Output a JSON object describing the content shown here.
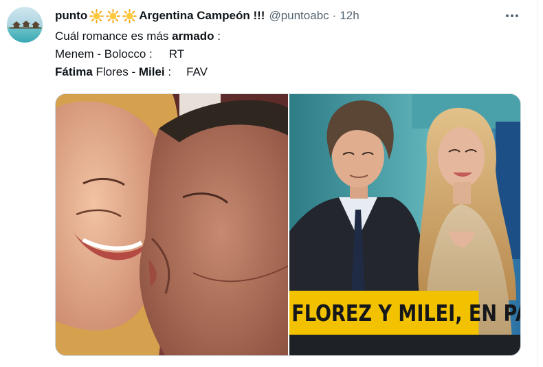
{
  "tweet": {
    "author": {
      "name": "punto",
      "name_suffix": "Argentina Campeón !!!",
      "name_emoji": [
        "sun-emoji",
        "sun-emoji",
        "sun-emoji"
      ],
      "handle": "@puntoabc",
      "separator": "·",
      "time": "12h",
      "avatar_icon": "beach-huts-avatar"
    },
    "more_icon": "more-horizontal-icon",
    "text": {
      "line1_prefix": "Cuál romance es más ",
      "line1_bold": "armado",
      "line1_suffix": " :",
      "line2_couple": "Menem - Bolocco :",
      "line2_action": "RT",
      "line3_bold1": "Fátima",
      "line3_mid": " Flores - ",
      "line3_bold2": "Milei",
      "line3_colon": " :",
      "line3_action": "FAV"
    },
    "media": {
      "left_image": "menem-bolocco-kiss-photo",
      "right_image": "milei-fatima-flores-tv-photo",
      "right_banner": "FLOREZ Y MILEI, EN PARE"
    }
  }
}
